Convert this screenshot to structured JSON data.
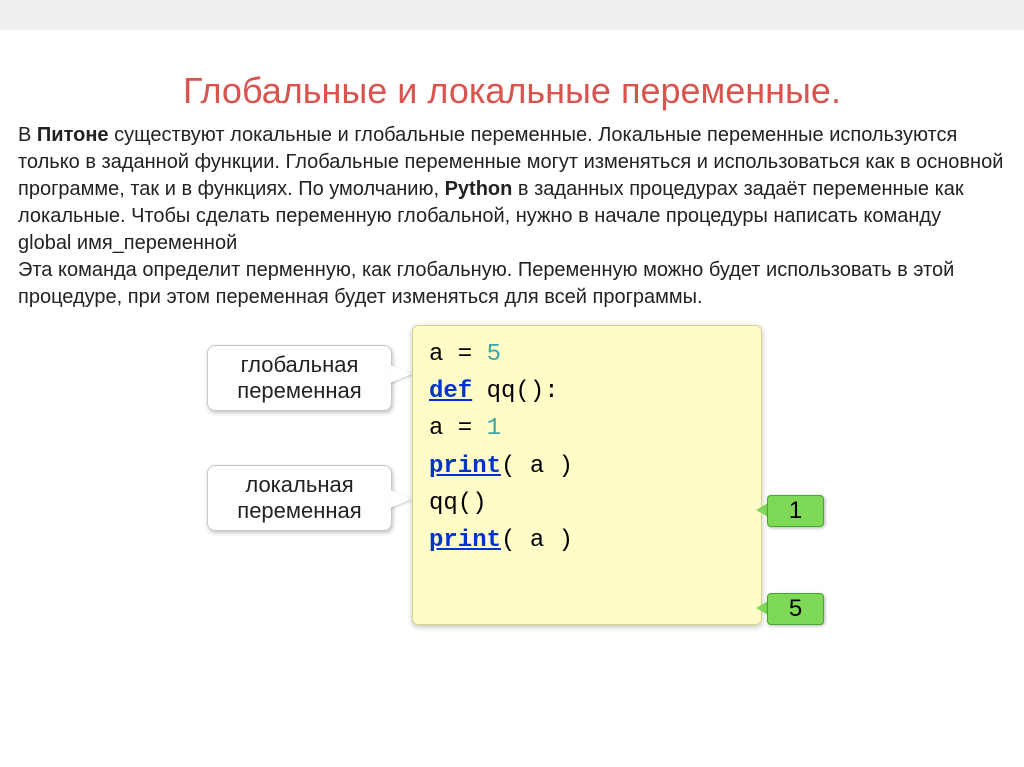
{
  "title": "Глобальные и локальные переменные.",
  "paragraph": {
    "lead": "В ",
    "lang": "Питоне",
    "p1": " существуют локальные и глобальные переменные. Локальные переменные используются только в заданной функции. Глобальные переменные могут изменяться и использоваться как  в основной программе, так и в функциях. По умолчанию, ",
    "python": "Python",
    "p2": " в заданных процедурах задаёт переменные как локальные. Чтобы сделать переменную глобальной, нужно в начале процедуры написать команду",
    "cmd": "global имя_переменной",
    "p3": "Эта команда определит перменную, как глобальную. Переменную можно будет использовать в этой процедуре, при этом переменная будет изменяться для всей программы."
  },
  "labels": {
    "global": "глобальная переменная",
    "local": "локальная переменная"
  },
  "code": {
    "l1a": "a = ",
    "l1b": "5",
    "l2a": "def",
    "l2b": " qq():",
    "l3a": "  a = ",
    "l3b": "1",
    "l4a": "  ",
    "l4b": "print",
    "l4c": "( a )",
    "l5": "qq()",
    "l6a": "print",
    "l6b": "( a )"
  },
  "outputs": {
    "first": "1",
    "second": "5"
  }
}
